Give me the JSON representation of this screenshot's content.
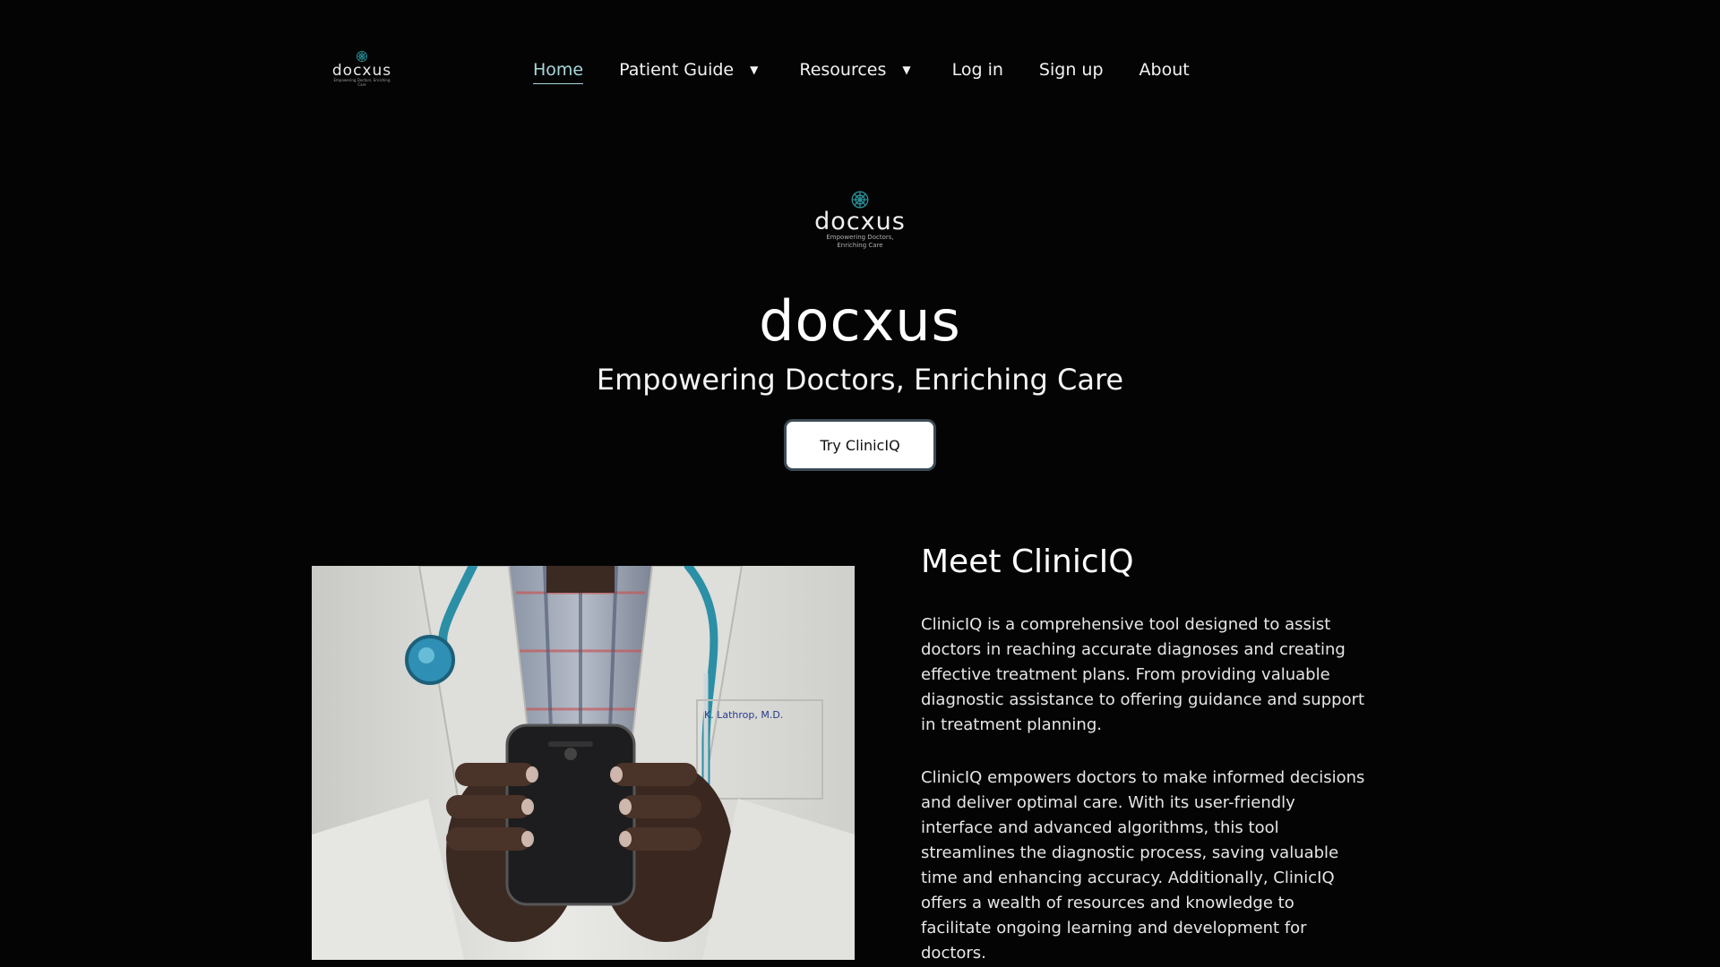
{
  "nav": {
    "logo": {
      "wordmark": "docxus",
      "tagline": "Empowering Doctors, Enriching Care"
    },
    "items": [
      {
        "label": "Home",
        "active": true,
        "has_dropdown": false
      },
      {
        "label": "Patient Guide",
        "active": false,
        "has_dropdown": true
      },
      {
        "label": "Resources",
        "active": false,
        "has_dropdown": true
      },
      {
        "label": "Log in",
        "active": false,
        "has_dropdown": false
      },
      {
        "label": "Sign up",
        "active": false,
        "has_dropdown": false
      },
      {
        "label": "About",
        "active": false,
        "has_dropdown": false
      }
    ],
    "dropdown_icon": "caret-down-icon"
  },
  "hero": {
    "logo": {
      "wordmark": "docxus",
      "tagline_line1": "Empowering Doctors,",
      "tagline_line2": "Enriching Care"
    },
    "title": "docxus",
    "subtitle": "Empowering Doctors, Enriching Care",
    "cta_label": "Try ClinicIQ"
  },
  "content": {
    "image": "doctor-holding-smartphone-photo",
    "heading": "Meet ClinicIQ",
    "paragraphs": [
      "ClinicIQ is a comprehensive tool designed to assist doctors in reaching accurate diagnoses and creating effective treatment plans. From providing valuable diagnostic assistance to offering guidance and support in treatment planning.",
      "ClinicIQ empowers doctors to make informed decisions and deliver optimal care. With its user-friendly interface and advanced algorithms, this tool streamlines the diagnostic process, saving valuable time and enhancing accuracy. Additionally, ClinicIQ offers a wealth of resources and knowledge to facilitate ongoing learning and development for doctors."
    ]
  },
  "colors": {
    "background": "#040405",
    "accent_active_link": "#a9d7d9",
    "logo_mark": "#2a8f97",
    "cta_background": "#ffffff",
    "cta_ring": "#3b4b55"
  }
}
